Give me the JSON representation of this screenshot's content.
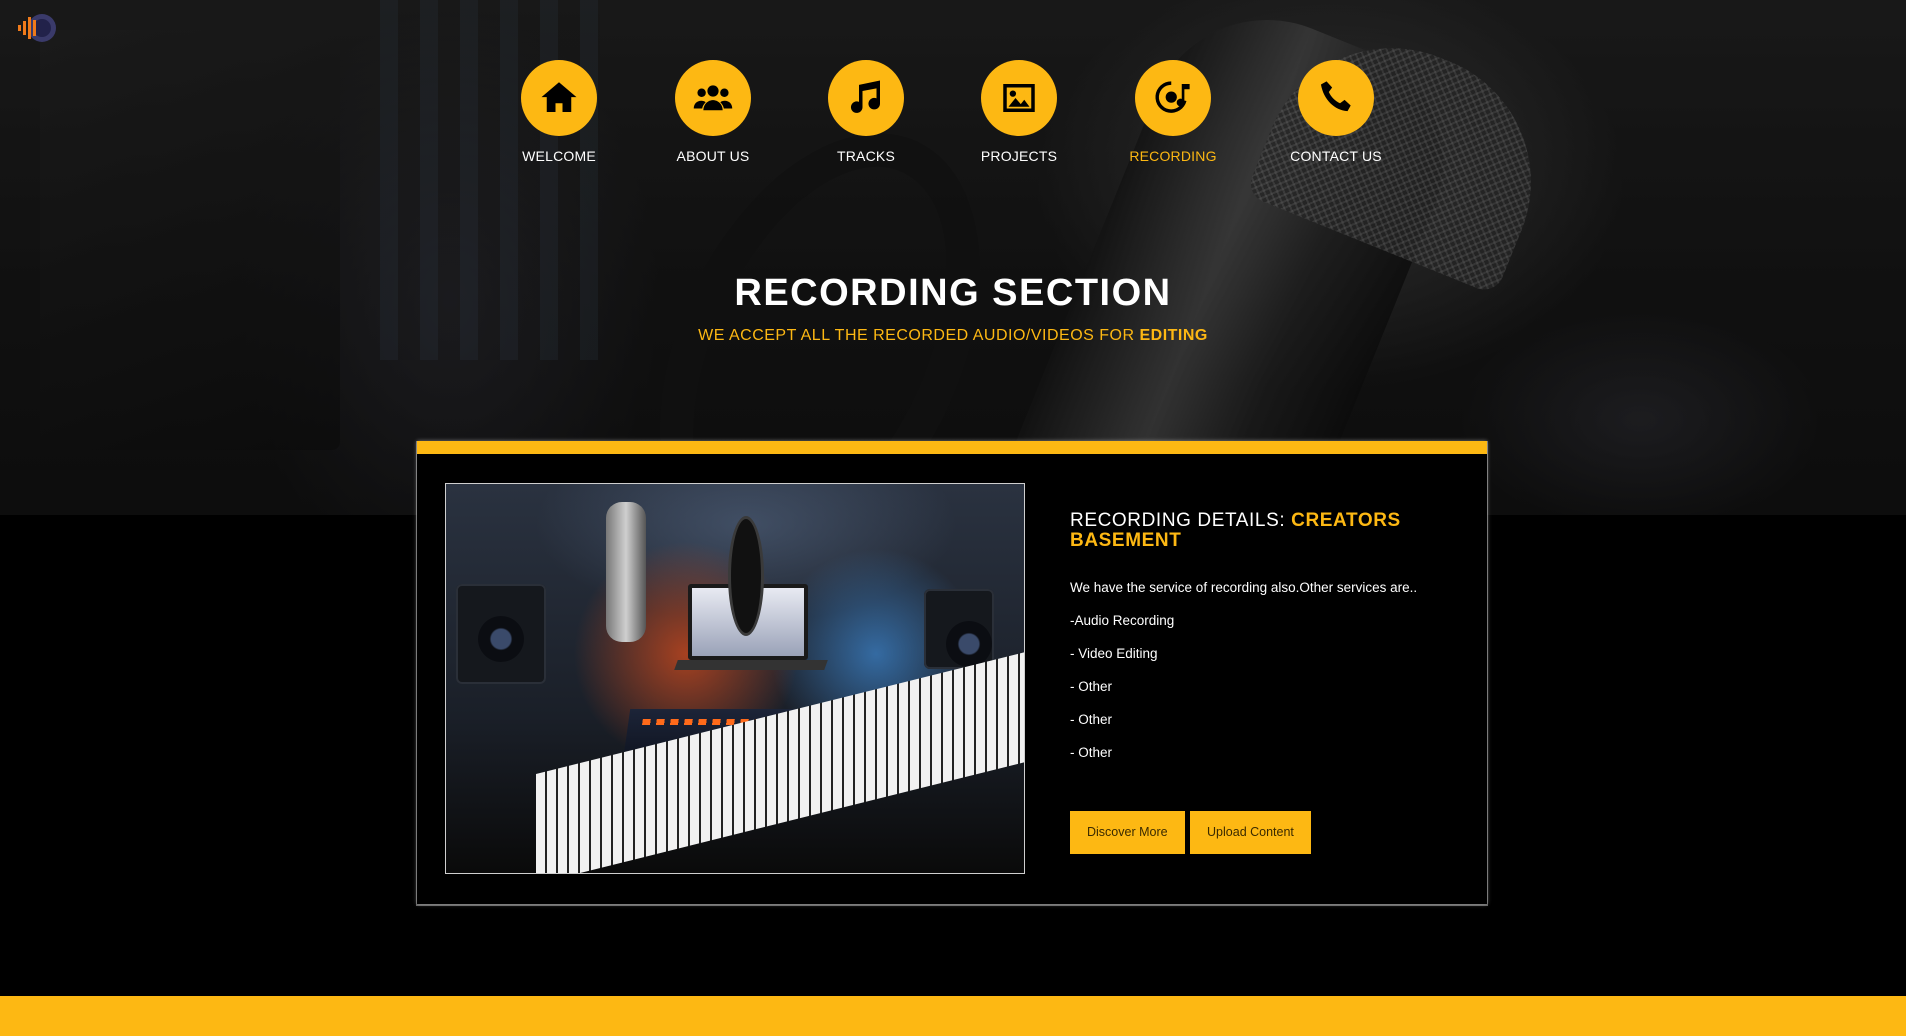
{
  "nav": {
    "items": [
      {
        "label": "WELCOME",
        "icon": "home-icon"
      },
      {
        "label": "ABOUT US",
        "icon": "users-icon"
      },
      {
        "label": "TRACKS",
        "icon": "music-note-icon"
      },
      {
        "label": "PROJECTS",
        "icon": "image-icon"
      },
      {
        "label": "RECORDING",
        "icon": "vinyl-record-icon",
        "active": true
      },
      {
        "label": "CONTACT US",
        "icon": "phone-icon"
      }
    ]
  },
  "section": {
    "title": "RECORDING SECTION",
    "subtitle": "WE ACCEPT ALL THE RECORDED AUDIO/VIDEOS FOR ",
    "subtitle_highlight": "EDITING"
  },
  "card": {
    "title_prefix": "RECORDING DETAILS: ",
    "title_highlight": "CREATORS BASEMENT",
    "intro": "We have the service of recording also.Other services are..",
    "services": [
      "-Audio Recording",
      "- Video Editing",
      "- Other",
      "- Other",
      "- Other"
    ],
    "buttons": {
      "discover": "Discover More",
      "upload": "Upload Content"
    }
  },
  "colors": {
    "accent": "#fdb813",
    "background": "#000000",
    "text": "#ffffff"
  }
}
